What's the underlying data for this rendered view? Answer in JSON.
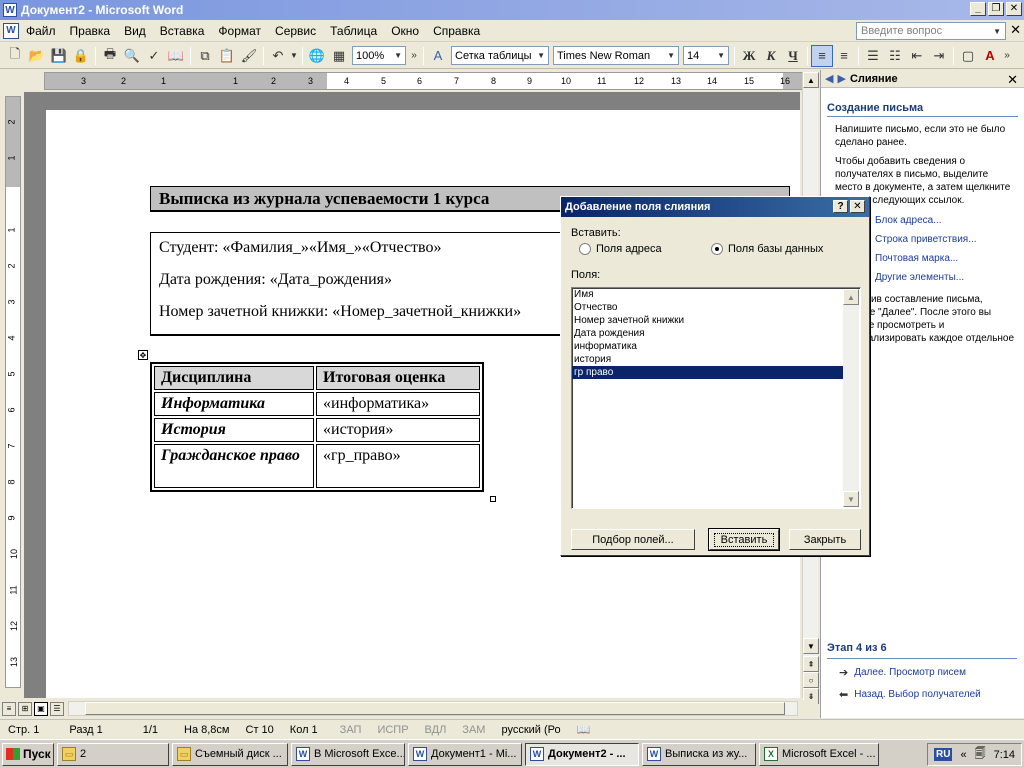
{
  "window": {
    "title": "Документ2 - Microsoft Word",
    "icon_letter": "W"
  },
  "menu": {
    "items": [
      "Файл",
      "Правка",
      "Вид",
      "Вставка",
      "Формат",
      "Сервис",
      "Таблица",
      "Окно",
      "Справка"
    ],
    "help_placeholder": "Введите вопрос"
  },
  "toolbar": {
    "zoom": "100%",
    "style": "Сетка таблицы",
    "font": "Times New Roman",
    "size": "14",
    "bold": "Ж",
    "italic": "К",
    "underline": "Ч"
  },
  "ruler": {
    "numbers": [
      "3",
      "2",
      "1",
      "1",
      "2",
      "3",
      "4",
      "5",
      "6",
      "7",
      "8",
      "9",
      "10",
      "11",
      "12",
      "13",
      "14",
      "15",
      "16"
    ]
  },
  "ruler_v": {
    "numbers": [
      "2",
      "1",
      "1",
      "2",
      "3",
      "4",
      "5",
      "6",
      "7",
      "8",
      "9",
      "10",
      "11",
      "12",
      "13"
    ]
  },
  "document": {
    "heading": "Выписка из журнала успеваемости 1 курса",
    "info": [
      "Студент: «Фамилия_»«Имя_»«Отчество»",
      "Дата рождения: «Дата_рождения»",
      "Номер зачетной книжки: «Номер_зачетной_книжки»"
    ],
    "table": {
      "headers": [
        "Дисциплина",
        "Итоговая оценка"
      ],
      "rows": [
        {
          "subject": "Информатика",
          "value": "«информатика»"
        },
        {
          "subject": "История",
          "value": "«история»"
        },
        {
          "subject": "Гражданское право",
          "value": "«гр_право»"
        }
      ]
    }
  },
  "dialog": {
    "title": "Добавление поля слияния",
    "help_btn": "?",
    "close_btn": "✕",
    "insert_label": "Вставить:",
    "radio_address": "Поля адреса",
    "radio_db": "Поля базы данных",
    "fields_label": "Поля:",
    "fields": [
      "Имя",
      "Отчество",
      "Номер зачетной книжки",
      "Дата рождения",
      "информатика",
      "история",
      "гр право"
    ],
    "selected_field": "гр право",
    "btn_match": "Подбор полей...",
    "btn_insert": "Вставить",
    "btn_close": "Закрыть"
  },
  "taskpane": {
    "title": "Слияние",
    "section": "Создание письма",
    "text1": "Напишите письмо, если это не было сделано ранее.",
    "text2": "Чтобы добавить сведения о получателях в письмо, выделите место в документе, а затем щелкните одну из следующих ссылок.",
    "links": [
      "Блок адреса...",
      "Строка приветствия...",
      "Почтовая марка...",
      "Другие элементы..."
    ],
    "text3": "Завершив составление письма, нажмите \"Далее\". После этого вы сможете просмотреть и персонализировать каждое отдельное письмо.",
    "step": "Этап 4 из 6",
    "next": "Далее. Просмотр писем",
    "back": "Назад. Выбор получателей"
  },
  "status": {
    "page": "Стр. 1",
    "section": "Разд 1",
    "pages": "1/1",
    "at": "На 8,8см",
    "line": "Ст 10",
    "col": "Кол 1",
    "rec": "ЗАП",
    "trk": "ИСПР",
    "ext": "ВДЛ",
    "ovr": "ЗАМ",
    "lang": "русский (Ро"
  },
  "taskbar": {
    "start": "Пуск",
    "folder_count": "2",
    "tasks": [
      {
        "label": "Съемный диск ...",
        "kind": "folder"
      },
      {
        "label": "В Microsoft Exce...",
        "kind": "word"
      },
      {
        "label": "Документ1 - Mi...",
        "kind": "word"
      },
      {
        "label": "Документ2 - ...",
        "kind": "word",
        "active": true
      },
      {
        "label": "Выписка из жу...",
        "kind": "word"
      },
      {
        "label": "Microsoft Excel - ...",
        "kind": "excel"
      }
    ],
    "lang": "RU",
    "clock": "7:14"
  }
}
